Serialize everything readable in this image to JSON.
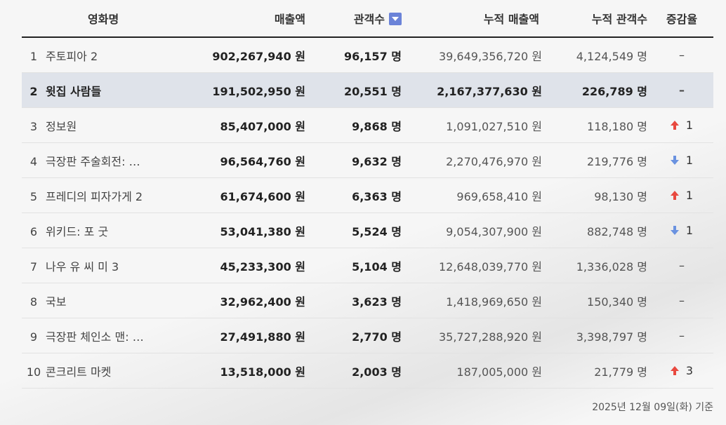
{
  "headers": {
    "title": "영화명",
    "revenue": "매출액",
    "audience": "관객수",
    "cum_revenue": "누적 매출액",
    "cum_audience": "누적 관객수",
    "change": "증감율"
  },
  "rows": [
    {
      "rank": "1",
      "title": "주토피아 2",
      "revenue": "902,267,940 원",
      "audience": "96,157 명",
      "cum_revenue": "39,649,356,720 원",
      "cum_audience": "4,124,549 명",
      "change_dir": "none",
      "change": "–"
    },
    {
      "rank": "2",
      "title": "윗집 사람들",
      "revenue": "191,502,950 원",
      "audience": "20,551 명",
      "cum_revenue": "2,167,377,630 원",
      "cum_audience": "226,789 명",
      "change_dir": "none",
      "change": "–"
    },
    {
      "rank": "3",
      "title": "정보원",
      "revenue": "85,407,000 원",
      "audience": "9,868 명",
      "cum_revenue": "1,091,027,510 원",
      "cum_audience": "118,180 명",
      "change_dir": "up",
      "change": "1"
    },
    {
      "rank": "4",
      "title": "극장판 주술회전: …",
      "revenue": "96,564,760 원",
      "audience": "9,632 명",
      "cum_revenue": "2,270,476,970 원",
      "cum_audience": "219,776 명",
      "change_dir": "down",
      "change": "1"
    },
    {
      "rank": "5",
      "title": "프레디의 피자가게 2",
      "revenue": "61,674,600 원",
      "audience": "6,363 명",
      "cum_revenue": "969,658,410 원",
      "cum_audience": "98,130 명",
      "change_dir": "up",
      "change": "1"
    },
    {
      "rank": "6",
      "title": "위키드: 포 굿",
      "revenue": "53,041,380 원",
      "audience": "5,524 명",
      "cum_revenue": "9,054,307,900 원",
      "cum_audience": "882,748 명",
      "change_dir": "down",
      "change": "1"
    },
    {
      "rank": "7",
      "title": "나우 유 씨 미 3",
      "revenue": "45,233,300 원",
      "audience": "5,104 명",
      "cum_revenue": "12,648,039,770 원",
      "cum_audience": "1,336,028 명",
      "change_dir": "none",
      "change": "–"
    },
    {
      "rank": "8",
      "title": "국보",
      "revenue": "32,962,400 원",
      "audience": "3,623 명",
      "cum_revenue": "1,418,969,650 원",
      "cum_audience": "150,340 명",
      "change_dir": "none",
      "change": "–"
    },
    {
      "rank": "9",
      "title": "극장판 체인소 맨: …",
      "revenue": "27,491,880 원",
      "audience": "2,770 명",
      "cum_revenue": "35,727,288,920 원",
      "cum_audience": "3,398,797 명",
      "change_dir": "none",
      "change": "–"
    },
    {
      "rank": "10",
      "title": "콘크리트 마켓",
      "revenue": "13,518,000 원",
      "audience": "2,003 명",
      "cum_revenue": "187,005,000 원",
      "cum_audience": "21,779 명",
      "change_dir": "up",
      "change": "3"
    }
  ],
  "highlight_row": 1,
  "footer": "2025년 12월 09일(화) 기준",
  "colors": {
    "up": "#e8493f",
    "down": "#6a92e0",
    "sort": "#6b83d8",
    "highlight": "#dfe3ea"
  }
}
